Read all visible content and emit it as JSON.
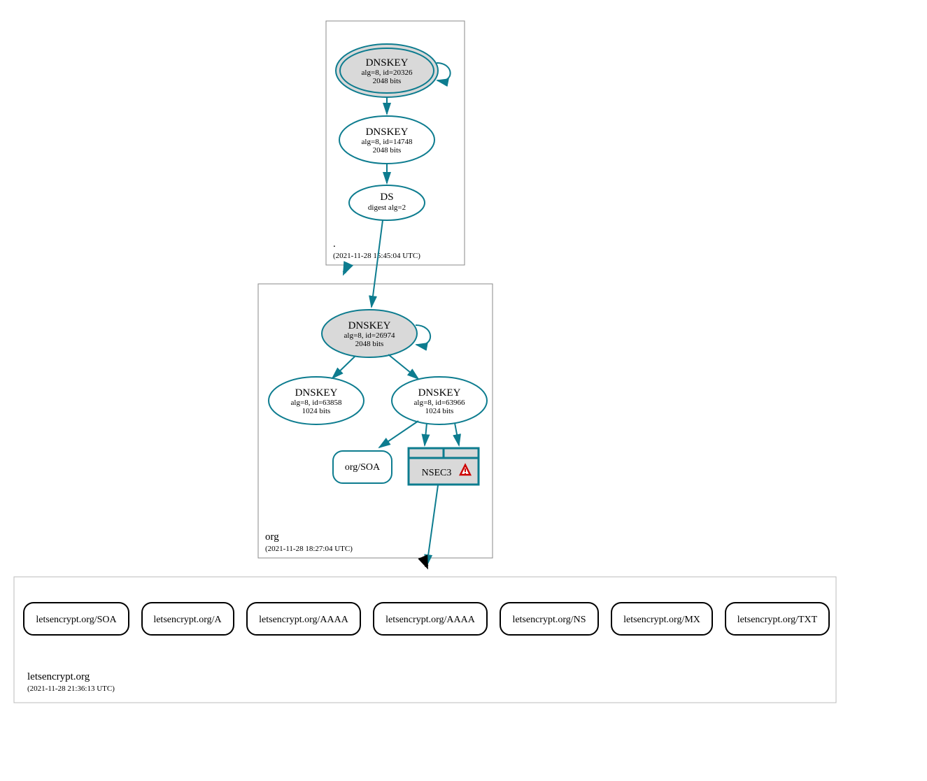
{
  "zones": {
    "root": {
      "label": ".",
      "timestamp": "(2021-11-28 15:45:04 UTC)"
    },
    "org": {
      "label": "org",
      "timestamp": "(2021-11-28 18:27:04 UTC)"
    },
    "le": {
      "label": "letsencrypt.org",
      "timestamp": "(2021-11-28 21:36:13 UTC)"
    }
  },
  "nodes": {
    "root_ksk": {
      "title": "DNSKEY",
      "line2": "alg=8, id=20326",
      "line3": "2048 bits"
    },
    "root_zsk": {
      "title": "DNSKEY",
      "line2": "alg=8, id=14748",
      "line3": "2048 bits"
    },
    "root_ds": {
      "title": "DS",
      "line2": "digest alg=2"
    },
    "org_ksk": {
      "title": "DNSKEY",
      "line2": "alg=8, id=26974",
      "line3": "2048 bits"
    },
    "org_zsk1": {
      "title": "DNSKEY",
      "line2": "alg=8, id=63858",
      "line3": "1024 bits"
    },
    "org_zsk2": {
      "title": "DNSKEY",
      "line2": "alg=8, id=63966",
      "line3": "1024 bits"
    },
    "org_soa": {
      "title": "org/SOA"
    },
    "org_nsec3": {
      "title": "NSEC3"
    }
  },
  "le_rrsets": [
    {
      "label": "letsencrypt.org/SOA"
    },
    {
      "label": "letsencrypt.org/A"
    },
    {
      "label": "letsencrypt.org/AAAA"
    },
    {
      "label": "letsencrypt.org/AAAA"
    },
    {
      "label": "letsencrypt.org/NS"
    },
    {
      "label": "letsencrypt.org/MX"
    },
    {
      "label": "letsencrypt.org/TXT"
    }
  ]
}
